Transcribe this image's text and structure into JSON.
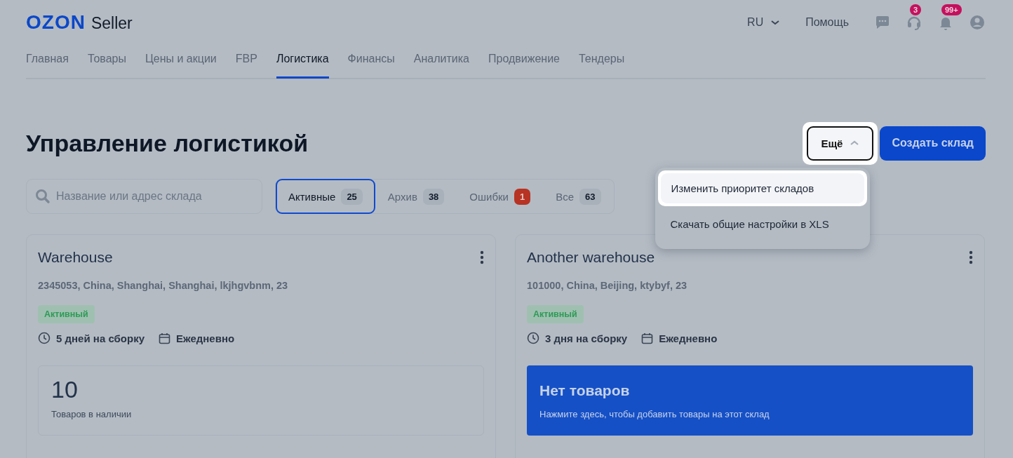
{
  "header": {
    "logo": "OZON",
    "logo_suffix": "Seller",
    "language": "RU",
    "help": "Помощь",
    "icons": [
      {
        "kind": "chat"
      },
      {
        "kind": "support",
        "badge": "3"
      },
      {
        "kind": "bell",
        "badge": "99+"
      },
      {
        "kind": "account"
      }
    ]
  },
  "nav": [
    {
      "label": "Главная",
      "selected": false
    },
    {
      "label": "Товары",
      "selected": false
    },
    {
      "label": "Цены и акции",
      "selected": false
    },
    {
      "label": "FBP",
      "selected": false
    },
    {
      "label": "Логистика",
      "selected": true
    },
    {
      "label": "Финансы",
      "selected": false
    },
    {
      "label": "Аналитика",
      "selected": false
    },
    {
      "label": "Продвижение",
      "selected": false
    },
    {
      "label": "Тендеры",
      "selected": false
    }
  ],
  "title": "Управление логистикой",
  "more_button": {
    "label": "Ещё",
    "expanded": true
  },
  "create_button": "Создать склад",
  "menu": [
    {
      "label": "Изменить приоритет складов",
      "selected": true
    },
    {
      "label": "Скачать общие настройки в XLS",
      "selected": false
    }
  ],
  "search": {
    "placeholder": "Название или адрес склада"
  },
  "filters": [
    {
      "label": "Активные",
      "count": "25",
      "selected": true,
      "error": false
    },
    {
      "label": "Архив",
      "count": "38",
      "selected": false,
      "error": false
    },
    {
      "label": "Ошибки",
      "count": "1",
      "selected": false,
      "error": true
    },
    {
      "label": "Все",
      "count": "63",
      "selected": false,
      "error": false
    }
  ],
  "warehouses": [
    {
      "name": "Warehouse",
      "address": "2345053, China, Shanghai, Shanghai, lkjhgvbnm, 23",
      "status": "Активный",
      "assembly": "5 дней на сборку",
      "schedule": "Ежедневно",
      "kind": "stock",
      "stock": {
        "value": "10",
        "caption": "Товаров в наличии"
      }
    },
    {
      "name": "Another warehouse",
      "address": "101000, China, Beijing, ktybyf, 23",
      "status": "Активный",
      "assembly": "3 дня на сборку",
      "schedule": "Ежедневно",
      "kind": "empty",
      "empty": {
        "title": "Нет товаров",
        "caption": "Нажмите здесь, чтобы добавить товары на этот склад"
      }
    }
  ]
}
